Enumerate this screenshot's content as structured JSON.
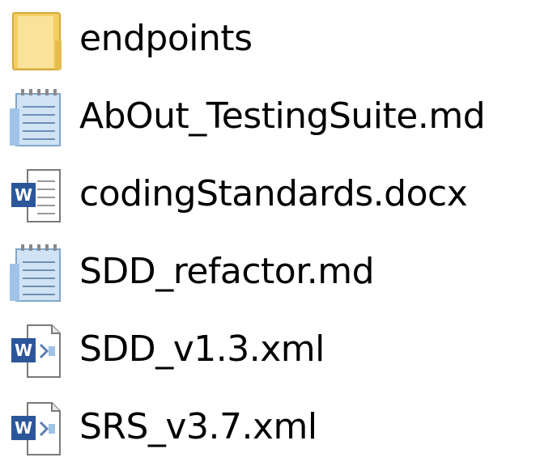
{
  "files": [
    {
      "name": "endpoints",
      "icon": "folder-icon"
    },
    {
      "name": "AbOut_TestingSuite.md",
      "icon": "text-document-icon"
    },
    {
      "name": "codingStandards.docx",
      "icon": "word-document-icon"
    },
    {
      "name": "SDD_refactor.md",
      "icon": "text-document-icon"
    },
    {
      "name": "SDD_v1.3.xml",
      "icon": "word-xml-document-icon"
    },
    {
      "name": "SRS_v3.7.xml",
      "icon": "word-xml-document-icon"
    }
  ],
  "colors": {
    "folder_fill": "#f7d774",
    "folder_edge": "#d9b24a",
    "word_blue": "#2b579a",
    "notepad_blue": "#8fb6d8"
  }
}
